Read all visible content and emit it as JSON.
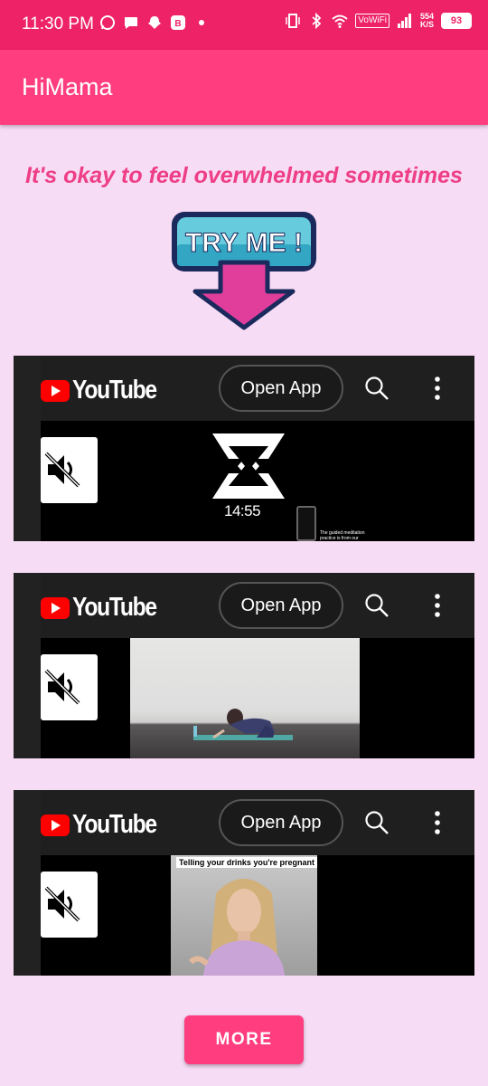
{
  "status_bar": {
    "time": "11:30 PM",
    "vowifi_label": "VoWiFi",
    "net_speed_value": "554",
    "net_speed_unit": "K/S",
    "battery_level": "93",
    "colors": {
      "background": "#ee2266"
    }
  },
  "app_bar": {
    "title": "HiMama",
    "color": "#ff3d7f"
  },
  "tagline": "It's okay to feel overwhelmed sometimes",
  "try_me": {
    "label": "TRY ME !"
  },
  "videos": [
    {
      "logo_text": "YouTube",
      "open_app_label": "Open App",
      "duration": "14:55",
      "phone_caption": "The guided meditation practice is from our app Declutter The Mind"
    },
    {
      "logo_text": "YouTube",
      "open_app_label": "Open App"
    },
    {
      "logo_text": "YouTube",
      "open_app_label": "Open App",
      "thumbnail_caption": "Telling your drinks you're pregnant"
    }
  ],
  "more_button": {
    "label": "MORE"
  },
  "icons": [
    "whatsapp-icon",
    "message-icon",
    "snapchat-icon",
    "app-b-icon",
    "vibrate-icon",
    "bluetooth-icon",
    "wifi-icon",
    "signal-icon",
    "battery-icon",
    "search-icon",
    "more-vert-icon",
    "mute-icon",
    "play-icon"
  ]
}
